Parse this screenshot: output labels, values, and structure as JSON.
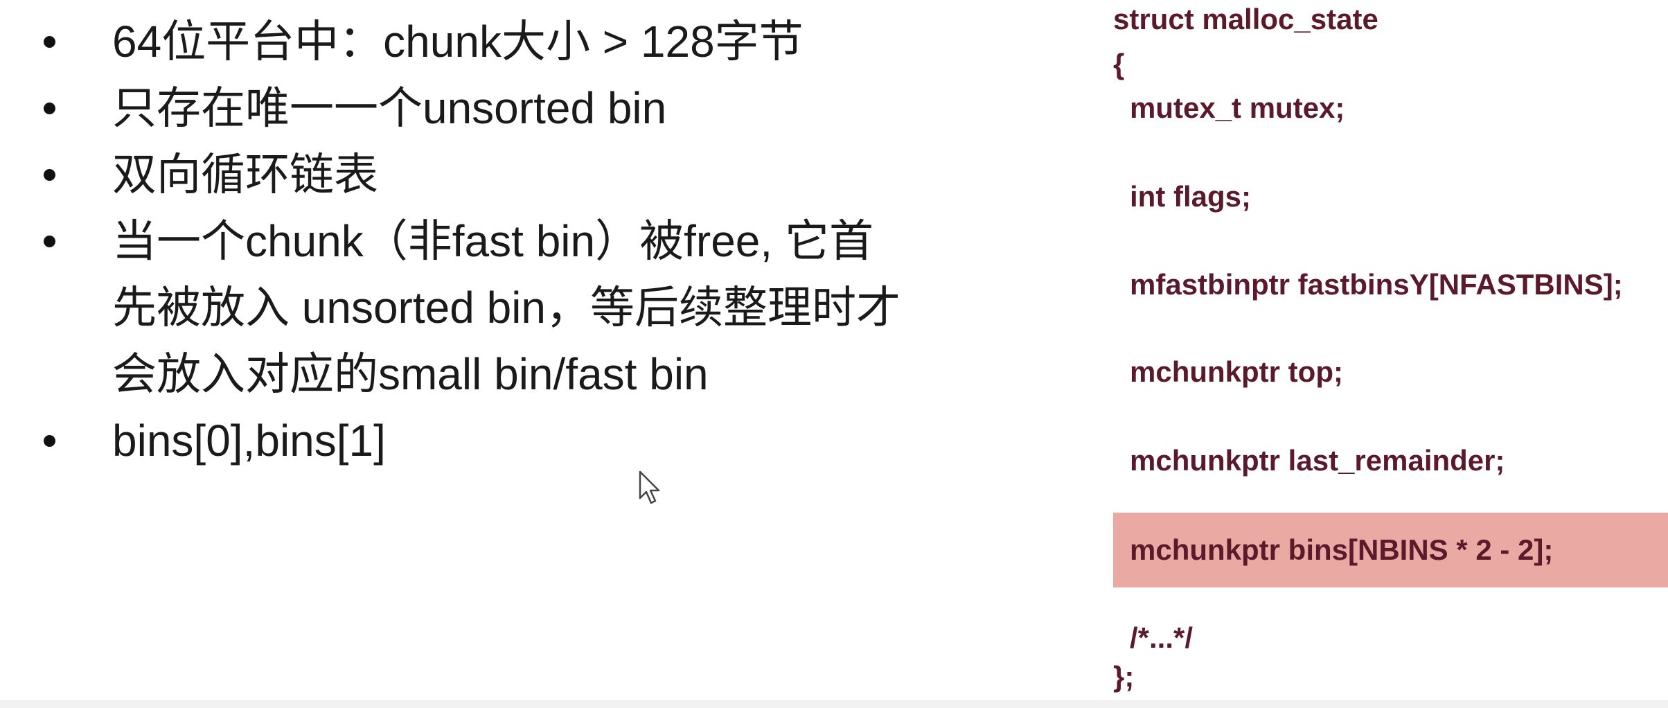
{
  "bullets": [
    {
      "lines": [
        "64位平台中：chunk大小 > 128字节"
      ]
    },
    {
      "lines": [
        "只存在唯一一个unsorted bin"
      ]
    },
    {
      "lines": [
        "双向循环链表"
      ]
    },
    {
      "lines": [
        "当一个chunk（非fast bin）被free, 它首",
        "先被放入 unsorted bin，等后续整理时才",
        "会放入对应的small bin/fast bin"
      ]
    },
    {
      "lines": [
        "bins[0],bins[1]"
      ]
    }
  ],
  "code": {
    "struct_decl": "struct malloc_state",
    "open_brace": "{",
    "fields": [
      "mutex_t mutex;",
      "int flags;",
      "mfastbinptr fastbinsY[NFASTBINS];",
      "mchunkptr top;",
      "mchunkptr last_remainder;",
      "mchunkptr bins[NBINS * 2 - 2];",
      "/*...*/"
    ],
    "close_brace": "};",
    "highlighted_field_index": 5,
    "highlight_color": "#eaa9a2",
    "text_color": "#5b1a2c"
  }
}
